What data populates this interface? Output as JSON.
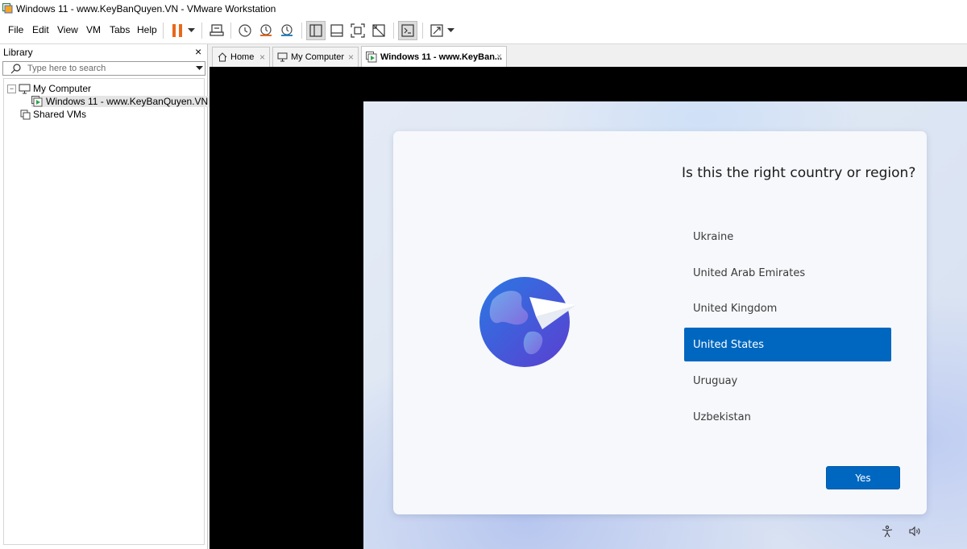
{
  "window": {
    "title": "Windows 11 - www.KeyBanQuyen.VN - VMware Workstation"
  },
  "menu": {
    "items": [
      "File",
      "Edit",
      "View",
      "VM",
      "Tabs",
      "Help"
    ]
  },
  "toolbar": {
    "icons": [
      "pause-icon",
      "dropdown-arrow-icon",
      "send-ctrl-alt-del-icon",
      "take-snapshot-icon",
      "revert-snapshot-icon",
      "snapshot-manager-icon",
      "show-library-icon",
      "show-thumbnail-bar-icon",
      "full-screen-icon",
      "unity-icon",
      "console-view-icon",
      "stretch-guest-icon",
      "dropdown-arrow-icon"
    ],
    "accent": "#e8681a"
  },
  "library": {
    "title": "Library",
    "close": "×",
    "search_placeholder": "Type here to search",
    "tree": {
      "expander": "−",
      "my_computer": "My Computer",
      "vm": "Windows 11 - www.KeyBanQuyen.VN",
      "shared": "Shared VMs"
    }
  },
  "tabs": [
    {
      "label": "Home",
      "icon": "home-icon",
      "active": false
    },
    {
      "label": "My Computer",
      "icon": "computer-icon",
      "active": false
    },
    {
      "label": "Windows 11 - www.KeyBan...",
      "icon": "vm-running-icon",
      "active": true
    }
  ],
  "tab_close": "×",
  "oobe": {
    "question": "Is this the right country or region?",
    "countries": [
      "Ukraine",
      "United Arab Emirates",
      "United Kingdom",
      "United States",
      "Uruguay",
      "Uzbekistan"
    ],
    "selected": "United States",
    "yes_label": "Yes",
    "accent": "#0067c0"
  }
}
